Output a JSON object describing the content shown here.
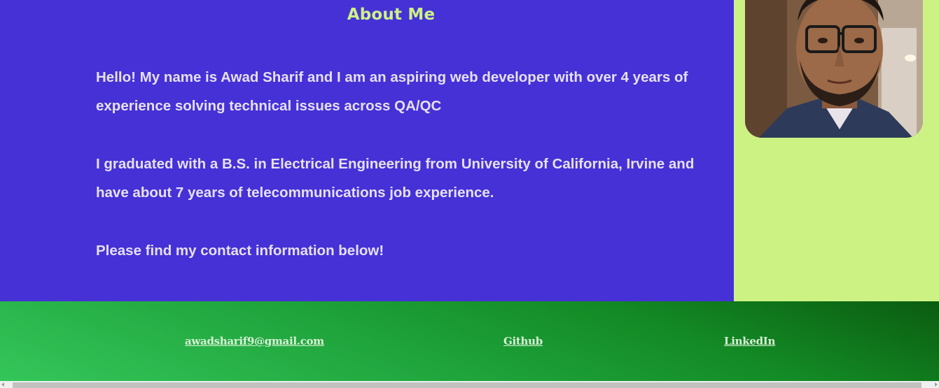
{
  "about": {
    "title": "About Me",
    "paragraphs": [
      "Hello! My name is Awad Sharif and I am an aspiring web developer with over 4 years of experience solving technical issues across QA/QC",
      "I graduated with a B.S. in Electrical Engineering from University of California, Irvine and have about 7 years of telecommunications job experience.",
      "Please find my contact information below!"
    ]
  },
  "contact": {
    "email": "awadsharif9@gmail.com",
    "github": "Github",
    "linkedin": "LinkedIn"
  },
  "colors": {
    "about_bg": "#4531d6",
    "accent_green": "#cdf284",
    "footer_start": "#34c65a",
    "footer_end": "#0b5c10"
  }
}
